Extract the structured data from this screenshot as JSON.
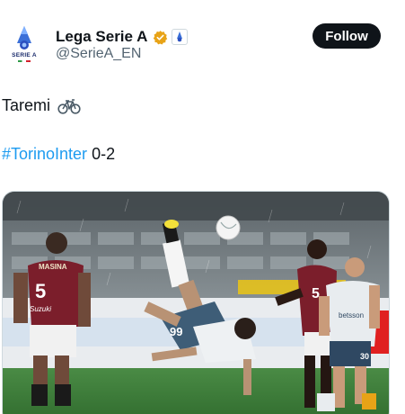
{
  "account": {
    "display_name": "Lega Serie A",
    "handle": "@SerieA_EN",
    "avatar_text": "SERIE A"
  },
  "follow_label": "Follow",
  "tweet": {
    "line1": "Taremi",
    "hashtag": "#TorinoInter",
    "score": " 0-2"
  },
  "media": {
    "player_left_name": "MASINA",
    "player_left_number": "5",
    "player_left_sponsor": "Suzuki",
    "player_center_number": "99",
    "player_right_back_number": "5",
    "player_right_sponsor": "betsson",
    "player_right_number": "30"
  },
  "colors": {
    "accent": "#1d9bf0",
    "verified": "#e8a317",
    "torino": "#7b1e2b",
    "pitch": "#3e7d3a"
  }
}
